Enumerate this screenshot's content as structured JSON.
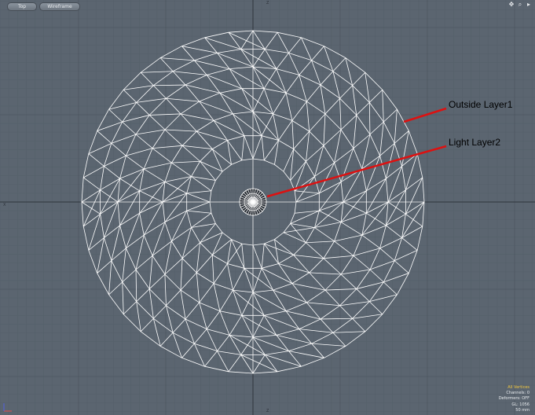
{
  "viewport": {
    "view_label": "Top",
    "shading_label": "Wireframe"
  },
  "toolbar_icons": [
    "move-view-icon",
    "zoom-view-icon",
    "viewport-menu-icon"
  ],
  "annotations": {
    "outside_layer": "Outside Layer1",
    "light_layer": "Light Layer2"
  },
  "axis_ticks": {
    "top": "Z",
    "bottom": "Z",
    "left": "X"
  },
  "hud": {
    "selection_mode": "All Vertices",
    "channels": "Channels: 0",
    "deformers": "Deformers: OFF",
    "gl_count": "GL: 1056",
    "grid_size": "50 mm"
  },
  "colors": {
    "background": "#5b6570",
    "mesh_wire": "#ffffff",
    "annotation_arrow": "#dd1111",
    "hud_highlight": "#f0c640"
  }
}
